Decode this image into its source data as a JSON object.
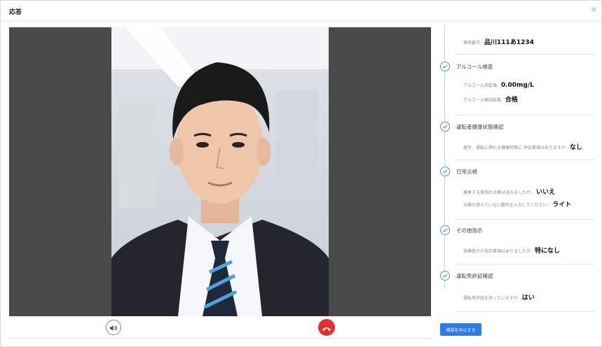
{
  "dialog": {
    "title": "応答",
    "close_icon": "close-icon"
  },
  "video": {
    "volume_icon": "speaker-icon",
    "hangup_icon": "phone-hangup-icon",
    "hangup_color": "#e0322a"
  },
  "steps": {
    "vehicle": {
      "label": "車両番号:",
      "value": "品川111あ1234"
    },
    "alcohol": {
      "title": "アルコール検査",
      "rows": [
        {
          "label": "アルコール測定値:",
          "value": "0.00mg/L"
        },
        {
          "label": "アルコール検知結果:",
          "value": "合格"
        }
      ]
    },
    "health": {
      "title": "運転者健康状態確認",
      "rows": [
        {
          "label": "疲労、運転に関わる健康状態に 申告事項はありますか:",
          "value": "なし"
        }
      ]
    },
    "daily": {
      "title": "日常点検",
      "rows": [
        {
          "label": "乗車する車両の点検は済みましたか :",
          "value": "いいえ"
        },
        {
          "label": "点検が済んでいない箇所を入力してください :",
          "value": "ライト"
        }
      ]
    },
    "other": {
      "title": "その他指示",
      "rows": [
        {
          "label": "指導者から指示事項はありましたか:",
          "value": "特になし"
        }
      ]
    },
    "license": {
      "title": "運転免許証確認",
      "rows": [
        {
          "label": "運転免許証を持っていますか:",
          "value": "はい"
        }
      ]
    }
  },
  "footer": {
    "cancel_label": "確認を中止する"
  },
  "colors": {
    "accent": "#2f7ae5",
    "check": "#5d8fd0"
  }
}
